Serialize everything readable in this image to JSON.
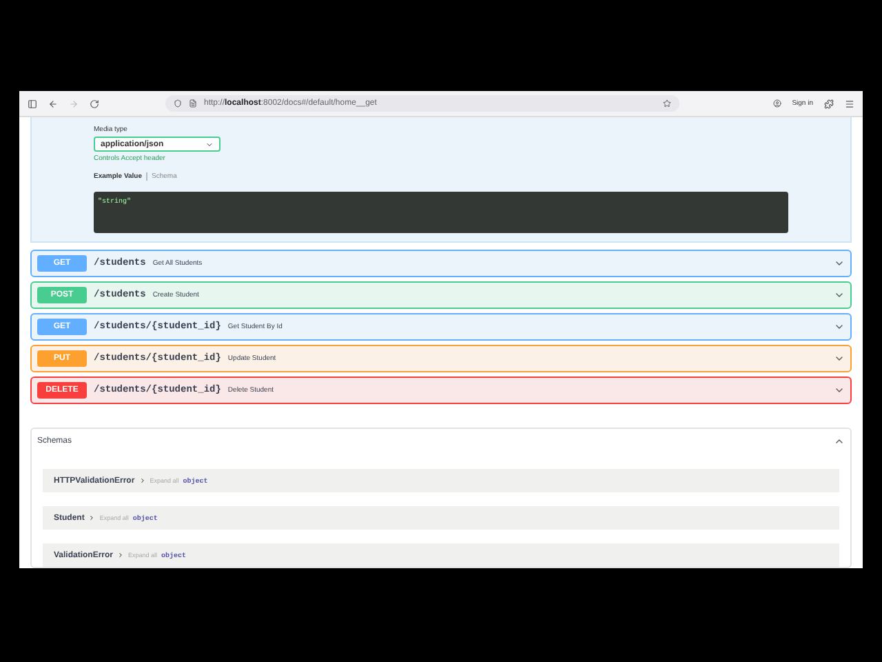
{
  "browser": {
    "url": "http://**localhost**:8002/docs#/default/home__get",
    "sign_in": "Sign in"
  },
  "response_panel": {
    "media_type_label": "Media type",
    "media_type": "application/json",
    "hint": "Controls Accept header",
    "example_tabs": [
      {
        "label": "Example Value",
        "selected": true
      },
      {
        "label": "Schema",
        "selected": false
      }
    ],
    "example": "\"string\""
  },
  "operations": [
    {
      "method": "GET",
      "path": "/students",
      "summary": "Get All Students",
      "expanded": false
    },
    {
      "method": "POST",
      "path": "/students",
      "summary": "Create Student",
      "expanded": false
    },
    {
      "method": "GET",
      "path": "/students/{student_id}",
      "summary": "Get Student By Id",
      "expanded": false
    },
    {
      "method": "PUT",
      "path": "/students/{student_id}",
      "summary": "Update Student",
      "expanded": false
    },
    {
      "method": "DELETE",
      "path": "/students/{student_id}",
      "summary": "Delete Student",
      "expanded": false
    }
  ],
  "schemas": {
    "title": "Schemas",
    "expanded": true,
    "models": [
      {
        "name": "HTTPValidationError",
        "expand_label": "Expand all",
        "type": "object"
      },
      {
        "name": "Student",
        "expand_label": "Expand all",
        "type": "object"
      },
      {
        "name": "ValidationError",
        "expand_label": "Expand all",
        "type": "object"
      }
    ]
  }
}
